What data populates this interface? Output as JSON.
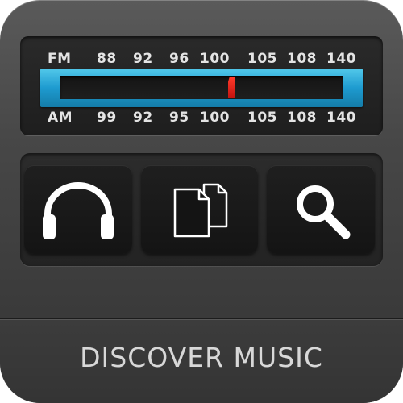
{
  "tuner": {
    "fm_label": "FM",
    "fm_frequencies": [
      "88",
      "92",
      "96",
      "100",
      "105",
      "108",
      "140"
    ],
    "am_label": "AM",
    "am_frequencies": [
      "99",
      "92",
      "95",
      "100",
      "105",
      "108",
      "140"
    ],
    "dial_color": "#1e9bd0",
    "needle_color": "#e0201a"
  },
  "buttons": {
    "headphones_icon": "headphones-icon",
    "documents_icon": "documents-icon",
    "search_icon": "search-icon"
  },
  "footer": {
    "title": "DISCOVER MUSIC"
  }
}
